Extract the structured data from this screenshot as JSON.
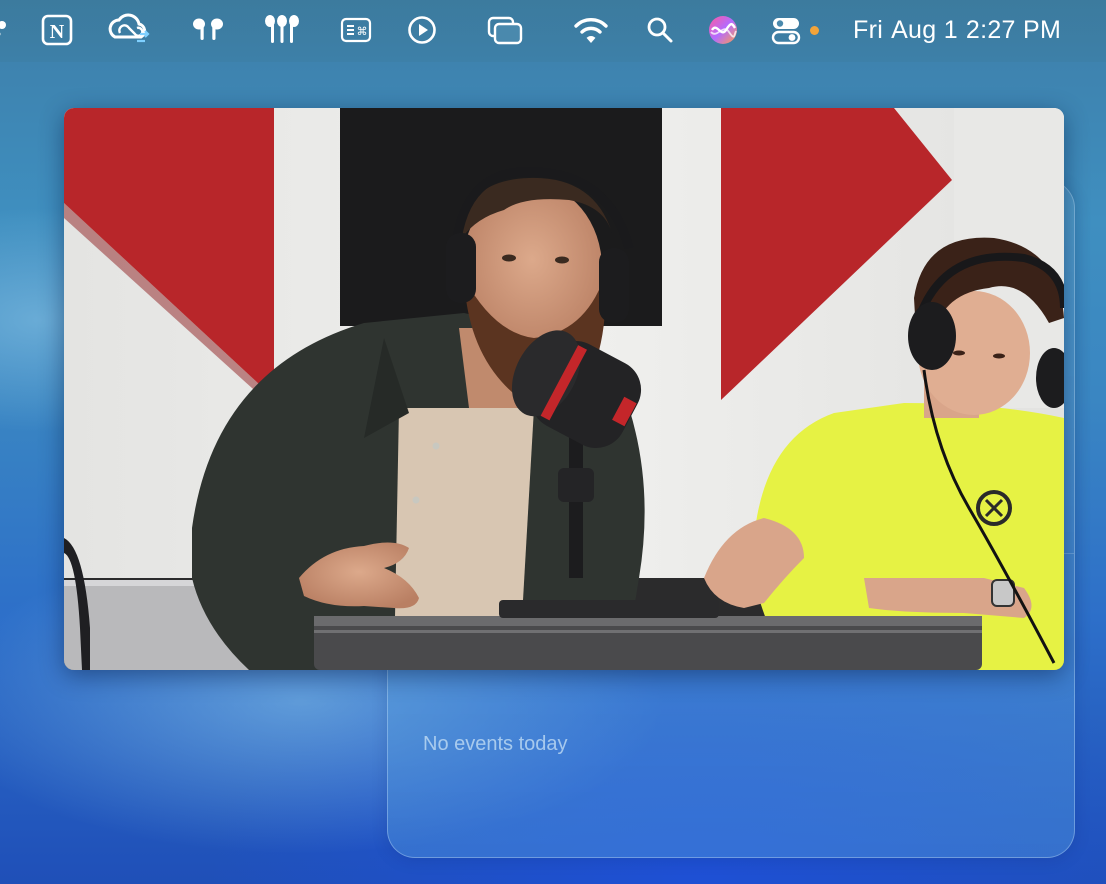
{
  "menubar": {
    "icons": [
      {
        "name": "app-dot-icon"
      },
      {
        "name": "notion-icon",
        "glyph": "N"
      },
      {
        "name": "creative-cloud-icon"
      },
      {
        "name": "airpods-icon"
      },
      {
        "name": "airpods-max-icon"
      },
      {
        "name": "keyboard-shortcut-icon",
        "glyph": "⌘"
      },
      {
        "name": "play-circle-icon"
      },
      {
        "name": "window-stack-icon"
      },
      {
        "name": "wifi-icon"
      },
      {
        "name": "spotlight-search-icon"
      },
      {
        "name": "siri-icon"
      },
      {
        "name": "control-center-icon"
      }
    ],
    "clock": {
      "day": "Fri",
      "date": "Aug 1",
      "time": "2:27 PM"
    },
    "status_dot_color": "#f3a43a"
  },
  "video": {
    "content": "podcast-studio-video"
  },
  "widget": {
    "empty_message": "No events today"
  }
}
